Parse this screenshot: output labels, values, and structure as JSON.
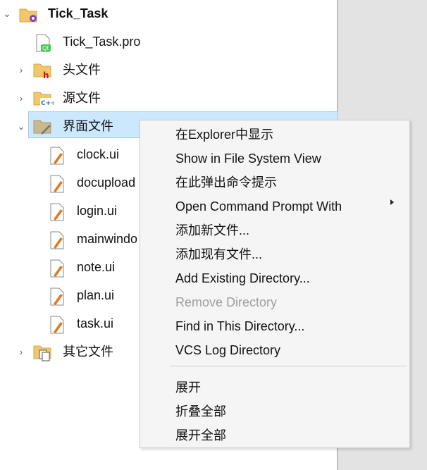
{
  "tree": {
    "root": {
      "label": "Tick_Task"
    },
    "items": [
      {
        "label": "Tick_Task.pro"
      },
      {
        "label": "头文件"
      },
      {
        "label": "源文件"
      },
      {
        "label": "界面文件"
      },
      {
        "label": "clock.ui"
      },
      {
        "label": "docupload"
      },
      {
        "label": "login.ui"
      },
      {
        "label": "mainwindo"
      },
      {
        "label": "note.ui"
      },
      {
        "label": "plan.ui"
      },
      {
        "label": "task.ui"
      },
      {
        "label": "其它文件"
      }
    ]
  },
  "context_menu": {
    "items": [
      {
        "label": "在Explorer中显示"
      },
      {
        "label": "Show in File System View"
      },
      {
        "label": "在此弹出命令提示"
      },
      {
        "label": "Open Command Prompt With"
      },
      {
        "label": "添加新文件..."
      },
      {
        "label": "添加现有文件..."
      },
      {
        "label": "Add Existing Directory..."
      },
      {
        "label": "Remove Directory"
      },
      {
        "label": "Find in This Directory..."
      },
      {
        "label": "VCS Log Directory"
      },
      {
        "label": "展开"
      },
      {
        "label": "折叠全部"
      },
      {
        "label": "展开全部"
      }
    ]
  },
  "colors": {
    "selection": "#cce8ff",
    "folder": "#f2c66b",
    "qt_green": "#41cd52",
    "header_red": "#c8102e",
    "cpp_blue": "#2f6fb5",
    "ui_pencil": "#e07a1f"
  },
  "icons": {
    "project": "project-gear-folder-icon",
    "pro_file": "qt-pro-file-icon",
    "headers": "header-folder-icon",
    "sources": "cpp-folder-icon",
    "forms": "ui-folder-icon",
    "ui_file": "ui-file-pencil-icon",
    "other": "other-files-folder-icon"
  }
}
